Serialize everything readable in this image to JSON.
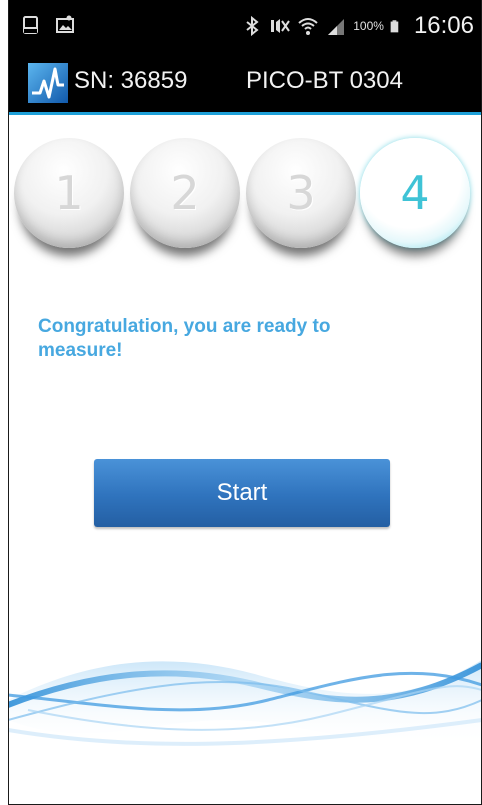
{
  "status_bar": {
    "battery_percent": "100%",
    "time": "16:06",
    "left_icons": [
      "screen-icon",
      "gallery-notification-icon"
    ],
    "right_icons": [
      "bluetooth-icon",
      "mute-icon",
      "wifi-icon",
      "signal-icon",
      "battery-icon"
    ]
  },
  "action_bar": {
    "serial": "SN: 36859",
    "device": "PICO-BT 0304"
  },
  "steps": [
    {
      "number": "1",
      "active": false
    },
    {
      "number": "2",
      "active": false
    },
    {
      "number": "3",
      "active": false
    },
    {
      "number": "4",
      "active": true
    }
  ],
  "message": "Congratulation, you are ready to measure!",
  "start_button": {
    "label": "Start"
  },
  "colors": {
    "accent": "#1ea0d8",
    "message_text": "#47a8e0",
    "button": "#3478c2",
    "active_step": "#3fc3d6"
  }
}
